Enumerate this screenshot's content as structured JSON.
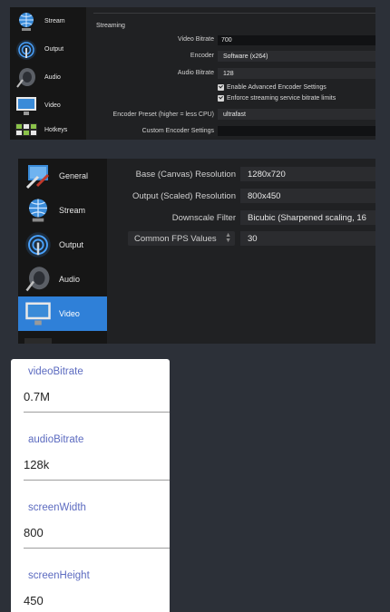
{
  "stream_panel": {
    "sidebar": [
      "Stream",
      "Output",
      "Audio",
      "Video",
      "Hotkeys"
    ],
    "section_title": "Streaming",
    "rows": [
      {
        "label": "Video Bitrate",
        "value": "700"
      },
      {
        "label": "Encoder",
        "value": "Software (x264)"
      },
      {
        "label": "Audio Bitrate",
        "value": "128"
      }
    ],
    "checkboxes": [
      {
        "label": "Enable Advanced Encoder Settings",
        "checked": true
      },
      {
        "label": "Enforce streaming service bitrate limits",
        "checked": true
      }
    ],
    "encoder_preset": {
      "label": "Encoder Preset (higher = less CPU)",
      "value": "ultrafast"
    },
    "custom_settings": {
      "label": "Custom Encoder Settings",
      "value": ""
    }
  },
  "video_panel": {
    "sidebar": [
      "General",
      "Stream",
      "Output",
      "Audio",
      "Video"
    ],
    "selected": "Video",
    "rows": [
      {
        "label": "Base (Canvas) Resolution",
        "value": "1280x720"
      },
      {
        "label": "Output (Scaled) Resolution",
        "value": "800x450"
      },
      {
        "label": "Downscale Filter",
        "value": "Bicubic (Sharpened scaling, 16"
      }
    ],
    "fps": {
      "label": "Common FPS Values",
      "value": "30"
    }
  },
  "form": {
    "fields": [
      {
        "label": "videoBitrate",
        "value": "0.7M"
      },
      {
        "label": "audioBitrate",
        "value": "128k"
      },
      {
        "label": "screenWidth",
        "value": "800"
      },
      {
        "label": "screenHeight",
        "value": "450"
      }
    ]
  },
  "colors": {
    "selected": "#2f80d8",
    "accent_label": "#5c6bc0"
  }
}
